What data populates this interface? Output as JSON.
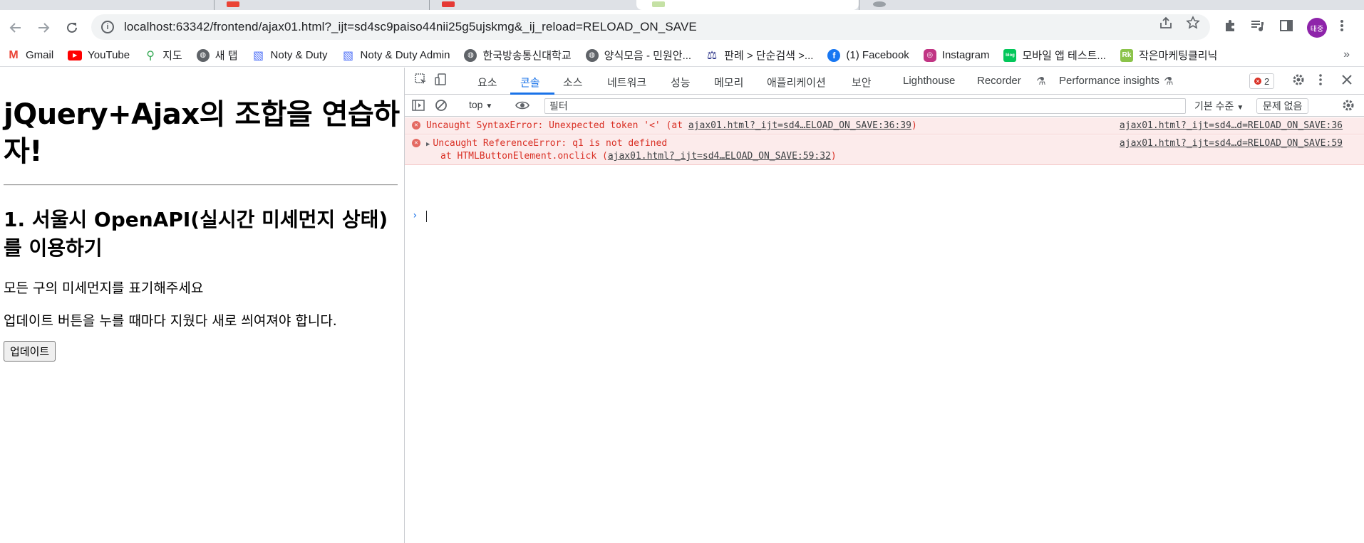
{
  "browser": {
    "url": "localhost:63342/frontend/ajax01.html?_ijt=sd4sc9paiso44nii25g5ujskmg&_ij_reload=RELOAD_ON_SAVE",
    "profile_initial": "태중"
  },
  "bookmarks": [
    {
      "label": "Gmail",
      "icon": "gmail-icon",
      "color": "#ea4335"
    },
    {
      "label": "YouTube",
      "icon": "youtube-icon",
      "color": "#ff0000"
    },
    {
      "label": "지도",
      "icon": "maps-icon",
      "color": "#34a853"
    },
    {
      "label": "새 탭",
      "icon": "globe-icon",
      "color": "#5f6368"
    },
    {
      "label": "Noty & Duty",
      "icon": "stripes-icon",
      "color": "#4a6cf7"
    },
    {
      "label": "Noty & Duty Admin",
      "icon": "stripes-icon",
      "color": "#4a6cf7"
    },
    {
      "label": "한국방송통신대학교",
      "icon": "globe-icon",
      "color": "#5f6368"
    },
    {
      "label": "양식모음 - 민원안...",
      "icon": "globe-icon",
      "color": "#5f6368"
    },
    {
      "label": "판례 > 단순검색 >...",
      "icon": "scale-icon",
      "color": "#1a237e"
    },
    {
      "label": "(1) Facebook",
      "icon": "facebook-icon",
      "color": "#1877f2"
    },
    {
      "label": "Instagram",
      "icon": "instagram-icon",
      "color": "#c13584"
    },
    {
      "label": "모바일 앱 테스트...",
      "icon": "blog-icon",
      "color": "#03c75a"
    },
    {
      "label": "작은마케팅클리닉",
      "icon": "rk-icon",
      "color": "#8bc34a"
    }
  ],
  "page": {
    "title": "jQuery+Ajax의 조합을 연습하자!",
    "subtitle": "1. 서울시 OpenAPI(실시간 미세먼지 상태)를 이용하기",
    "paragraph1": "모든 구의 미세먼지를 표기해주세요",
    "paragraph2": "업데이트 버튼을 누를 때마다 지웠다 새로 씌여져야 합니다.",
    "update_button": "업데이트"
  },
  "devtools": {
    "tabs": [
      "요소",
      "콘솔",
      "소스",
      "네트워크",
      "성능",
      "메모리",
      "애플리케이션",
      "보안",
      "Lighthouse",
      "Recorder",
      "Performance insights"
    ],
    "active_tab": "콘솔",
    "error_count": "2",
    "context": "top",
    "filter_placeholder": "필터",
    "levels": "기본 수준",
    "issues": "문제 없음",
    "errors": [
      {
        "message_prefix": "Uncaught SyntaxError: Unexpected token '<' (at ",
        "message_link": "ajax01.html?_ijt=sd4…ELOAD_ON_SAVE:36:39",
        "message_suffix": ")",
        "source": "ajax01.html?_ijt=sd4…d=RELOAD_ON_SAVE:36"
      },
      {
        "message_prefix": "Uncaught ReferenceError: q1 is not defined",
        "sub_prefix": "at HTMLButtonElement.onclick (",
        "sub_link": "ajax01.html?_ijt=sd4…ELOAD_ON_SAVE:59:32",
        "sub_suffix": ")",
        "source": "ajax01.html?_ijt=sd4…d=RELOAD_ON_SAVE:59"
      }
    ],
    "prompt": "›"
  },
  "colors": {
    "accent": "#1a73e8",
    "error_text": "#d93025",
    "error_bg": "#fcebeb"
  }
}
